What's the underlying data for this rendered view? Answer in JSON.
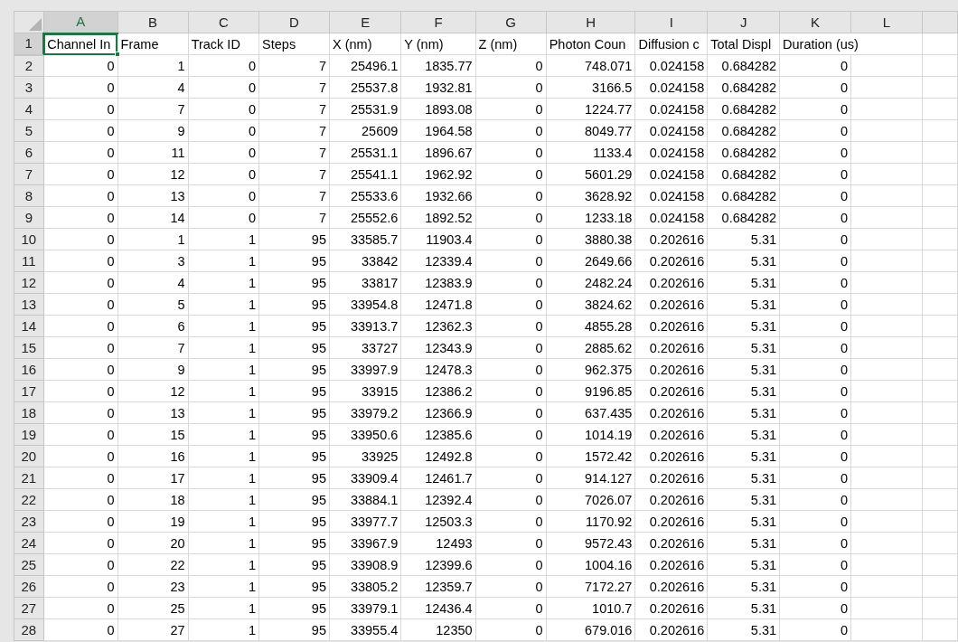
{
  "columns": [
    {
      "label": "A",
      "selected": true
    },
    {
      "label": "B",
      "selected": false
    },
    {
      "label": "C",
      "selected": false
    },
    {
      "label": "D",
      "selected": false
    },
    {
      "label": "E",
      "selected": false
    },
    {
      "label": "F",
      "selected": false
    },
    {
      "label": "G",
      "selected": false
    },
    {
      "label": "H",
      "selected": false
    },
    {
      "label": "I",
      "selected": false
    },
    {
      "label": "J",
      "selected": false
    },
    {
      "label": "K",
      "selected": false
    },
    {
      "label": "L",
      "selected": false
    }
  ],
  "rows": [
    {
      "number": "1",
      "kind": "header",
      "selected": true,
      "cells": [
        "Channel In",
        "Frame",
        "Track ID",
        "Steps",
        "X (nm)",
        "Y (nm)",
        "Z (nm)",
        "Photon Coun",
        "Diffusion c",
        "Total Displ",
        "Duration (us)"
      ]
    },
    {
      "number": "2",
      "kind": "data",
      "selected": false,
      "cells": [
        "0",
        "1",
        "0",
        "7",
        "25496.1",
        "1835.77",
        "0",
        "748.071",
        "0.024158",
        "0.684282",
        "0"
      ]
    },
    {
      "number": "3",
      "kind": "data",
      "selected": false,
      "cells": [
        "0",
        "4",
        "0",
        "7",
        "25537.8",
        "1932.81",
        "0",
        "3166.5",
        "0.024158",
        "0.684282",
        "0"
      ]
    },
    {
      "number": "4",
      "kind": "data",
      "selected": false,
      "cells": [
        "0",
        "7",
        "0",
        "7",
        "25531.9",
        "1893.08",
        "0",
        "1224.77",
        "0.024158",
        "0.684282",
        "0"
      ]
    },
    {
      "number": "5",
      "kind": "data",
      "selected": false,
      "cells": [
        "0",
        "9",
        "0",
        "7",
        "25609",
        "1964.58",
        "0",
        "8049.77",
        "0.024158",
        "0.684282",
        "0"
      ]
    },
    {
      "number": "6",
      "kind": "data",
      "selected": false,
      "cells": [
        "0",
        "11",
        "0",
        "7",
        "25531.1",
        "1896.67",
        "0",
        "1133.4",
        "0.024158",
        "0.684282",
        "0"
      ]
    },
    {
      "number": "7",
      "kind": "data",
      "selected": false,
      "cells": [
        "0",
        "12",
        "0",
        "7",
        "25541.1",
        "1962.92",
        "0",
        "5601.29",
        "0.024158",
        "0.684282",
        "0"
      ]
    },
    {
      "number": "8",
      "kind": "data",
      "selected": false,
      "cells": [
        "0",
        "13",
        "0",
        "7",
        "25533.6",
        "1932.66",
        "0",
        "3628.92",
        "0.024158",
        "0.684282",
        "0"
      ]
    },
    {
      "number": "9",
      "kind": "data",
      "selected": false,
      "cells": [
        "0",
        "14",
        "0",
        "7",
        "25552.6",
        "1892.52",
        "0",
        "1233.18",
        "0.024158",
        "0.684282",
        "0"
      ]
    },
    {
      "number": "10",
      "kind": "data",
      "selected": false,
      "cells": [
        "0",
        "1",
        "1",
        "95",
        "33585.7",
        "11903.4",
        "0",
        "3880.38",
        "0.202616",
        "5.31",
        "0"
      ]
    },
    {
      "number": "11",
      "kind": "data",
      "selected": false,
      "cells": [
        "0",
        "3",
        "1",
        "95",
        "33842",
        "12339.4",
        "0",
        "2649.66",
        "0.202616",
        "5.31",
        "0"
      ]
    },
    {
      "number": "12",
      "kind": "data",
      "selected": false,
      "cells": [
        "0",
        "4",
        "1",
        "95",
        "33817",
        "12383.9",
        "0",
        "2482.24",
        "0.202616",
        "5.31",
        "0"
      ]
    },
    {
      "number": "13",
      "kind": "data",
      "selected": false,
      "cells": [
        "0",
        "5",
        "1",
        "95",
        "33954.8",
        "12471.8",
        "0",
        "3824.62",
        "0.202616",
        "5.31",
        "0"
      ]
    },
    {
      "number": "14",
      "kind": "data",
      "selected": false,
      "cells": [
        "0",
        "6",
        "1",
        "95",
        "33913.7",
        "12362.3",
        "0",
        "4855.28",
        "0.202616",
        "5.31",
        "0"
      ]
    },
    {
      "number": "15",
      "kind": "data",
      "selected": false,
      "cells": [
        "0",
        "7",
        "1",
        "95",
        "33727",
        "12343.9",
        "0",
        "2885.62",
        "0.202616",
        "5.31",
        "0"
      ]
    },
    {
      "number": "16",
      "kind": "data",
      "selected": false,
      "cells": [
        "0",
        "9",
        "1",
        "95",
        "33997.9",
        "12478.3",
        "0",
        "962.375",
        "0.202616",
        "5.31",
        "0"
      ]
    },
    {
      "number": "17",
      "kind": "data",
      "selected": false,
      "cells": [
        "0",
        "12",
        "1",
        "95",
        "33915",
        "12386.2",
        "0",
        "9196.85",
        "0.202616",
        "5.31",
        "0"
      ]
    },
    {
      "number": "18",
      "kind": "data",
      "selected": false,
      "cells": [
        "0",
        "13",
        "1",
        "95",
        "33979.2",
        "12366.9",
        "0",
        "637.435",
        "0.202616",
        "5.31",
        "0"
      ]
    },
    {
      "number": "19",
      "kind": "data",
      "selected": false,
      "cells": [
        "0",
        "15",
        "1",
        "95",
        "33950.6",
        "12385.6",
        "0",
        "1014.19",
        "0.202616",
        "5.31",
        "0"
      ]
    },
    {
      "number": "20",
      "kind": "data",
      "selected": false,
      "cells": [
        "0",
        "16",
        "1",
        "95",
        "33925",
        "12492.8",
        "0",
        "1572.42",
        "0.202616",
        "5.31",
        "0"
      ]
    },
    {
      "number": "21",
      "kind": "data",
      "selected": false,
      "cells": [
        "0",
        "17",
        "1",
        "95",
        "33909.4",
        "12461.7",
        "0",
        "914.127",
        "0.202616",
        "5.31",
        "0"
      ]
    },
    {
      "number": "22",
      "kind": "data",
      "selected": false,
      "cells": [
        "0",
        "18",
        "1",
        "95",
        "33884.1",
        "12392.4",
        "0",
        "7026.07",
        "0.202616",
        "5.31",
        "0"
      ]
    },
    {
      "number": "23",
      "kind": "data",
      "selected": false,
      "cells": [
        "0",
        "19",
        "1",
        "95",
        "33977.7",
        "12503.3",
        "0",
        "1170.92",
        "0.202616",
        "5.31",
        "0"
      ]
    },
    {
      "number": "24",
      "kind": "data",
      "selected": false,
      "cells": [
        "0",
        "20",
        "1",
        "95",
        "33967.9",
        "12493",
        "0",
        "9572.43",
        "0.202616",
        "5.31",
        "0"
      ]
    },
    {
      "number": "25",
      "kind": "data",
      "selected": false,
      "cells": [
        "0",
        "22",
        "1",
        "95",
        "33908.9",
        "12399.6",
        "0",
        "1004.16",
        "0.202616",
        "5.31",
        "0"
      ]
    },
    {
      "number": "26",
      "kind": "data",
      "selected": false,
      "cells": [
        "0",
        "23",
        "1",
        "95",
        "33805.2",
        "12359.7",
        "0",
        "7172.27",
        "0.202616",
        "5.31",
        "0"
      ]
    },
    {
      "number": "27",
      "kind": "data",
      "selected": false,
      "cells": [
        "0",
        "25",
        "1",
        "95",
        "33979.1",
        "12436.4",
        "0",
        "1010.7",
        "0.202616",
        "5.31",
        "0"
      ]
    },
    {
      "number": "28",
      "kind": "data",
      "selected": false,
      "cells": [
        "0",
        "27",
        "1",
        "95",
        "33955.4",
        "12350",
        "0",
        "679.016",
        "0.202616",
        "5.31",
        "0"
      ]
    }
  ]
}
